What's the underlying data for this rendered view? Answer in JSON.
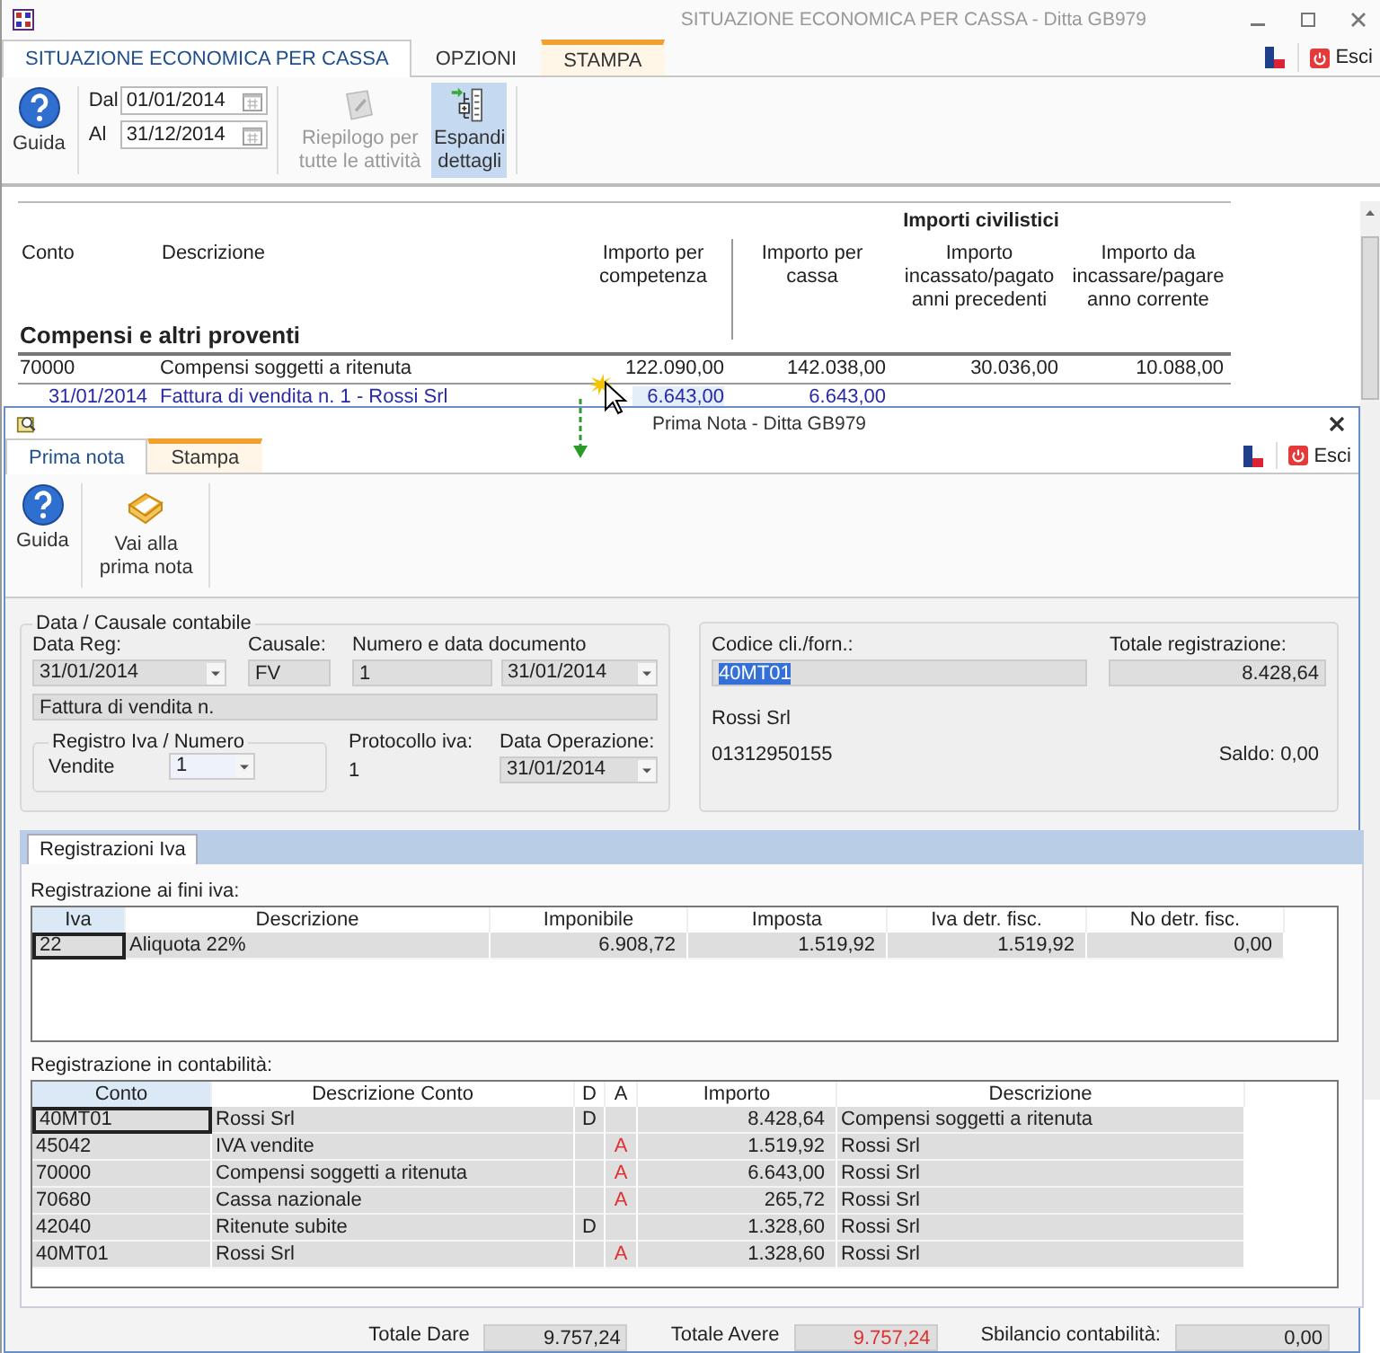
{
  "outer_window": {
    "title": "SITUAZIONE ECONOMICA PER CASSA - Ditta GB979",
    "tabs": [
      {
        "label": "SITUAZIONE ECONOMICA PER CASSA",
        "selected": true,
        "contextual": false
      },
      {
        "label": "OPZIONI",
        "selected": false,
        "contextual": false
      },
      {
        "label": "STAMPA",
        "selected": false,
        "contextual": true
      }
    ],
    "exit_label": "Esci",
    "ribbon": {
      "help_label": "Guida",
      "date_from": {
        "label": "Dal",
        "value": "01/01/2014"
      },
      "date_to": {
        "label": "Al",
        "value": "31/12/2014"
      },
      "buttons": [
        {
          "kind": "summary",
          "label": "Riepilogo per tutte le attività",
          "disabled": true,
          "active": false
        },
        {
          "kind": "expand",
          "label": "Espandi dettagli",
          "disabled": false,
          "active": true
        }
      ]
    },
    "report": {
      "group_header": "Importi civilistici",
      "columns": [
        "Conto",
        "Descrizione",
        "Importo per competenza",
        "Importo per cassa",
        "Importo incassato/pagato anni precedenti",
        "Importo da incassare/pagare anno corrente"
      ],
      "sections": [
        {
          "title": "Compensi e altri proventi",
          "rows": [
            {
              "kind": "account",
              "cells": [
                "70000",
                "Compensi soggetti a ritenuta",
                "122.090,00",
                "142.038,00",
                "30.036,00",
                "10.088,00"
              ]
            },
            {
              "kind": "detail",
              "cells": [
                "31/01/2014",
                "Fattura di vendita n. 1 -  Rossi Srl",
                "6.643,00",
                "6.643,00"
              ]
            }
          ]
        }
      ]
    }
  },
  "prima_nota": {
    "title": "Prima Nota - Ditta GB979",
    "tabs": [
      {
        "label": "Prima nota",
        "selected": true,
        "contextual": false
      },
      {
        "label": "Stampa",
        "selected": false,
        "contextual": true
      }
    ],
    "exit_label": "Esci",
    "ribbon": [
      {
        "kind": "help",
        "label": "Guida"
      },
      {
        "kind": "goto",
        "label": "Vai alla prima nota"
      }
    ],
    "causale": {
      "legend": "Data / Causale contabile",
      "data_reg": {
        "label": "Data Reg:",
        "value": "31/01/2014"
      },
      "causale": {
        "label": "Causale:",
        "value": "FV"
      },
      "documento": {
        "label": "Numero e data documento",
        "number": "1",
        "date": "31/01/2014"
      },
      "description": "Fattura di vendita n.",
      "registro": {
        "legend": "Registro Iva / Numero",
        "label": "Vendite",
        "value": "1"
      },
      "protocollo": {
        "label": "Protocollo iva:",
        "value": "1"
      },
      "data_operazione": {
        "label": "Data Operazione:",
        "value": "31/01/2014"
      }
    },
    "cliente": {
      "code_label": "Codice cli./forn.:",
      "code": "40MT01",
      "code_selected": true,
      "total_label": "Totale registrazione:",
      "total": "8.428,64",
      "name": "Rossi Srl",
      "vat_number": "01312950155",
      "balance": "Saldo: 0,00"
    },
    "detail_tabs": [
      {
        "label": "Registrazioni Iva",
        "selected": true
      }
    ],
    "iva": {
      "title": "Registrazione ai fini iva:",
      "columns": [
        "Iva",
        "Descrizione",
        "Imponibile",
        "Imposta",
        "Iva detr. fisc.",
        "No detr. fisc."
      ],
      "rows": [
        {
          "cells": [
            "22",
            "Aliquota 22%",
            "6.908,72",
            "1.519,92",
            "1.519,92",
            "0,00"
          ],
          "focused": true
        }
      ]
    },
    "contabilita": {
      "title": "Registrazione in contabilità:",
      "columns": [
        "Conto",
        "Descrizione Conto",
        "D",
        "A",
        "Importo",
        "Descrizione"
      ],
      "rows": [
        {
          "conto": "40MT01",
          "descrizione_conto": "Rossi Srl",
          "dare": "D",
          "importo": "8.428,64",
          "descrizione": "Compensi soggetti a ritenuta",
          "focused": true
        },
        {
          "conto": "45042",
          "descrizione_conto": "IVA vendite",
          "avere": "A",
          "importo": "1.519,92",
          "descrizione": "Rossi Srl",
          "focused": false
        },
        {
          "conto": "70000",
          "descrizione_conto": "Compensi soggetti a ritenuta",
          "avere": "A",
          "importo": "6.643,00",
          "descrizione": "Rossi Srl",
          "focused": false
        },
        {
          "conto": "70680",
          "descrizione_conto": "Cassa nazionale",
          "avere": "A",
          "importo": "265,72",
          "descrizione": "Rossi Srl",
          "focused": false
        },
        {
          "conto": "42040",
          "descrizione_conto": "Ritenute subite",
          "dare": "D",
          "importo": "1.328,60",
          "descrizione": "Rossi Srl",
          "focused": false
        },
        {
          "conto": "40MT01",
          "descrizione_conto": "Rossi Srl",
          "avere": "A",
          "importo": "1.328,60",
          "descrizione": "Rossi Srl",
          "focused": false
        }
      ]
    },
    "totals": [
      {
        "kind": "dare",
        "label": "Totale Dare",
        "value": "9.757,24"
      },
      {
        "kind": "avere",
        "label": "Totale Avere",
        "value": "9.757,24"
      },
      {
        "kind": "sbilancio",
        "label": "Sbilancio contabilità:",
        "value": "0,00"
      }
    ]
  }
}
